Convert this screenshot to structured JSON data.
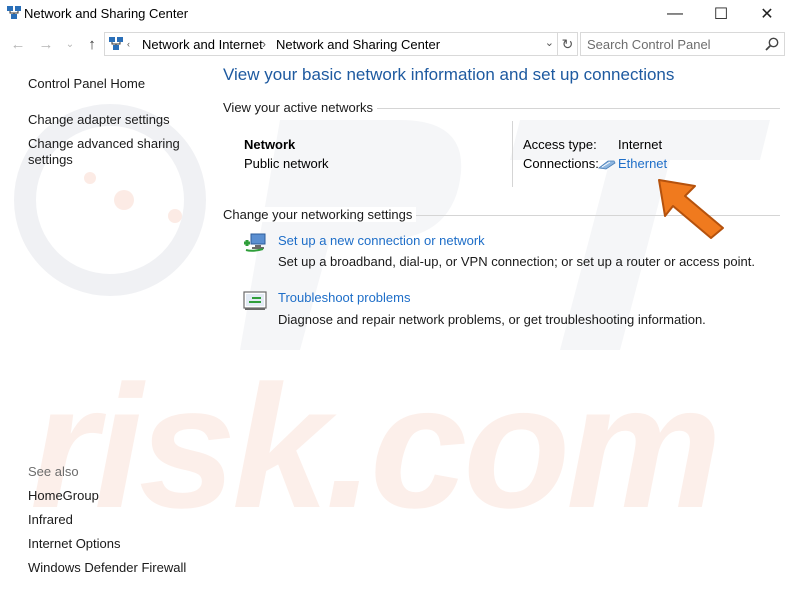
{
  "window": {
    "title": "Network and Sharing Center",
    "controls": {
      "minimize": "—",
      "maximize": "☐",
      "close": "✕"
    }
  },
  "address": {
    "crumbs": [
      "Network and Internet",
      "Network and Sharing Center"
    ],
    "search_placeholder": "Search Control Panel"
  },
  "sidebar": {
    "home": "Control Panel Home",
    "links": [
      "Change adapter settings",
      "Change advanced sharing",
      "settings"
    ],
    "see_also_heading": "See also",
    "see_also": [
      "HomeGroup",
      "Infrared",
      "Internet Options",
      "Windows Defender Firewall"
    ]
  },
  "main": {
    "title": "View your basic network information and set up connections",
    "active_heading": "View your active networks",
    "network": {
      "name": "Network",
      "category": "Public network",
      "access_label": "Access type:",
      "access_value": "Internet",
      "connections_label": "Connections:",
      "connection_link": "Ethernet"
    },
    "settings_heading": "Change your networking settings",
    "tasks": [
      {
        "link": "Set up a new connection or network",
        "desc": "Set up a broadband, dial-up, or VPN connection; or set up a router or access point."
      },
      {
        "link": "Troubleshoot problems",
        "desc": "Diagnose and repair network problems, or get troubleshooting information."
      }
    ]
  },
  "watermark": {
    "text": "risk.com"
  },
  "colors": {
    "link": "#1e6ec8",
    "title_blue": "#1e5aa0",
    "arrow_orange": "#f07a1e",
    "watermark": "#fbe3da"
  }
}
